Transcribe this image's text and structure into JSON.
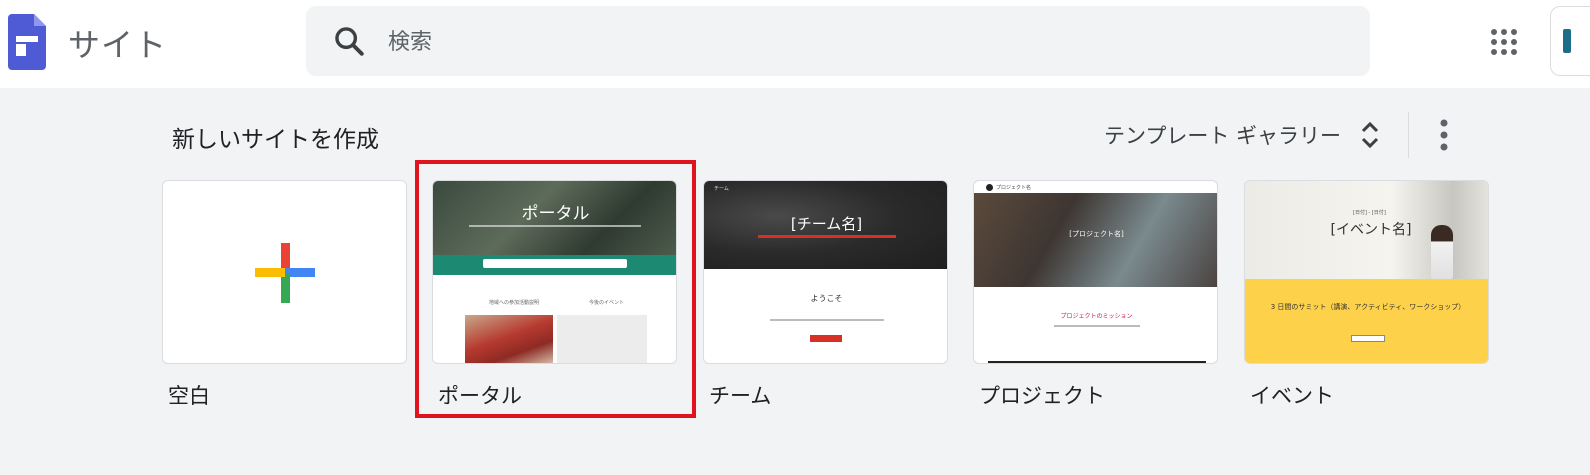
{
  "header": {
    "app_title": "サイト",
    "search_placeholder": "検索"
  },
  "section": {
    "title": "新しいサイトを作成",
    "gallery_label": "テンプレート ギャラリー"
  },
  "templates": [
    {
      "label": "空白"
    },
    {
      "label": "ポータル",
      "hero_title": "ポータル",
      "col_left": "地域への参加活動説明",
      "col_right": "今後のイベント"
    },
    {
      "label": "チーム",
      "hero_title": "[チーム名]",
      "welcome": "ようこそ",
      "nav_title": "チーム"
    },
    {
      "label": "プロジェクト",
      "hero_title": "[プロジェクト名]",
      "mission": "プロジェクトのミッション",
      "nav_title": "プロジェクト名"
    },
    {
      "label": "イベント",
      "hero_title": "[イベント名]",
      "date": "[日付] - [日付]",
      "summit": "3 日間のサミット（講演、アクティビティ、ワークショップ）"
    }
  ],
  "colors": {
    "accent_red": "#e0141e",
    "portal_teal": "#1c8a72",
    "event_yellow": "#fdd24a",
    "team_red": "#d93025",
    "project_pink": "#c2185b"
  }
}
